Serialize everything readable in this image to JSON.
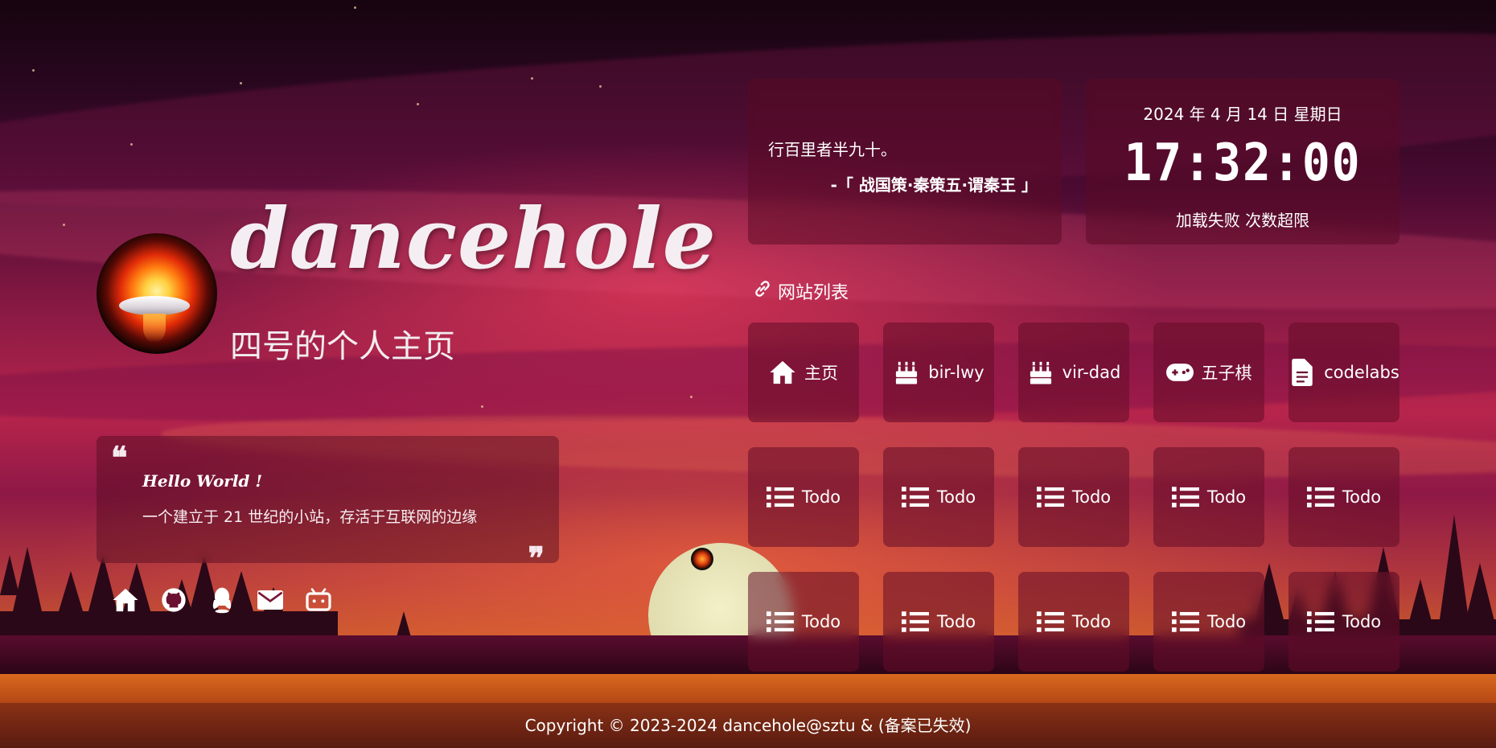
{
  "profile": {
    "site_name": "dancehole",
    "subtitle": "四号的个人主页"
  },
  "intro": {
    "quote_open": "❝",
    "quote_close": "❞",
    "title": "Hello World !",
    "text": "一个建立于 21 世纪的小站，存活于互联网的边缘"
  },
  "social": [
    {
      "icon": "home-icon"
    },
    {
      "icon": "github-icon"
    },
    {
      "icon": "qq-icon"
    },
    {
      "icon": "email-icon"
    },
    {
      "icon": "bilibili-icon"
    }
  ],
  "hitokoto": {
    "text": "行百里者半九十。",
    "from": "-「 战国策·秦策五·谓秦王 」"
  },
  "time": {
    "date": "2024 年 4 月 14 日 星期日",
    "clock": "17:32:00",
    "weather": "加载失败 次数超限"
  },
  "links": {
    "title": "网站列表",
    "items": [
      {
        "label": "主页",
        "icon": "home-icon"
      },
      {
        "label": "bir-lwy",
        "icon": "cake-icon"
      },
      {
        "label": "vir-dad",
        "icon": "cake-icon"
      },
      {
        "label": "五子棋",
        "icon": "gamepad-icon"
      },
      {
        "label": "codelabs",
        "icon": "file-icon"
      },
      {
        "label": "Todo",
        "icon": "list-icon"
      },
      {
        "label": "Todo",
        "icon": "list-icon"
      },
      {
        "label": "Todo",
        "icon": "list-icon"
      },
      {
        "label": "Todo",
        "icon": "list-icon"
      },
      {
        "label": "Todo",
        "icon": "list-icon"
      },
      {
        "label": "Todo",
        "icon": "list-icon"
      },
      {
        "label": "Todo",
        "icon": "list-icon"
      },
      {
        "label": "Todo",
        "icon": "list-icon"
      },
      {
        "label": "Todo",
        "icon": "list-icon"
      },
      {
        "label": "Todo",
        "icon": "list-icon"
      }
    ]
  },
  "footer": {
    "text": "Copyright © 2023-2024 dancehole@sztu & (备案已失效)"
  },
  "colors": {
    "card_bg": "#5a0a23",
    "text": "#ffffff",
    "accent_sky": "#b8254c"
  }
}
